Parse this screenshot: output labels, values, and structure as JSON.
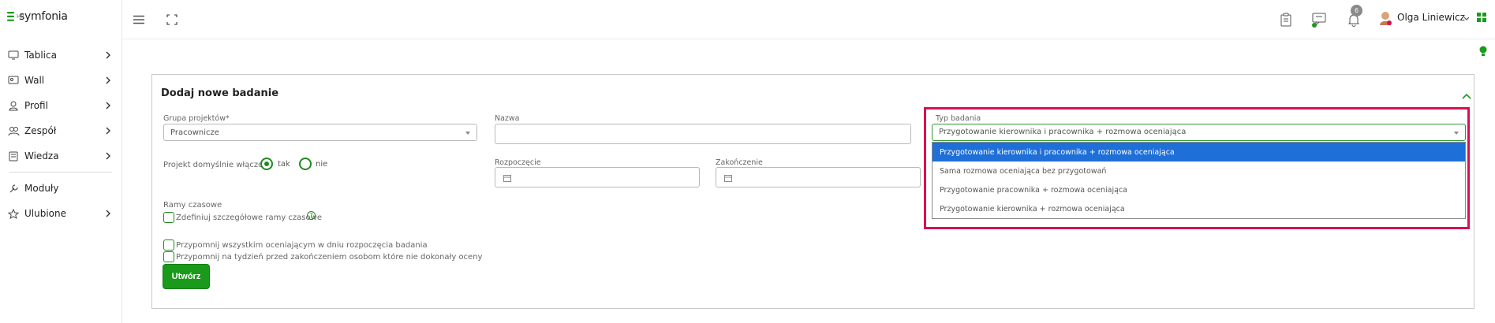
{
  "app": {
    "logo_text": "symfonia",
    "logo_sub": "HR"
  },
  "sidebar": {
    "items": [
      {
        "label": "Tablica",
        "icon": "monitor-icon"
      },
      {
        "label": "Wall",
        "icon": "wall-icon"
      },
      {
        "label": "Profil",
        "icon": "user-icon"
      },
      {
        "label": "Zespół",
        "icon": "team-icon"
      },
      {
        "label": "Wiedza",
        "icon": "book-icon"
      },
      {
        "label": "Moduły",
        "icon": "wrench-icon"
      },
      {
        "label": "Ulubione",
        "icon": "star-icon"
      }
    ]
  },
  "topbar": {
    "notification_count": "6",
    "user_name": "Olga Liniewicz"
  },
  "form": {
    "title": "Dodaj nowe badanie",
    "group_label": "Grupa projektów*",
    "group_value": "Pracownicze",
    "name_label": "Nazwa",
    "name_value": "",
    "type_label": "Typ badania",
    "type_value": "Przygotowanie kierownika i pracownika + rozmowa oceniająca",
    "default_project_label": "Projekt domyślnie włączony",
    "radio_yes": "tak",
    "radio_no": "nie",
    "start_label": "Rozpoczęcie",
    "end_label": "Zakończenie",
    "timeframe_label": "Ramy czasowe",
    "timeframe_checkbox": "Zdefiniuj szczegółowe ramy czasowe",
    "help_glyph": "?",
    "remind_all": "Przypomnij wszystkim oceniającym w dniu rozpoczęcia badania",
    "remind_week": "Przypomnij na tydzień przed zakończeniem osobom które nie dokonały oceny",
    "submit": "Utwórz"
  },
  "dropdown": {
    "options": [
      "Przygotowanie kierownika i pracownika + rozmowa oceniająca",
      "Sama rozmowa oceniająca bez przygotowań",
      "Przygotowanie pracownika + rozmowa oceniająca",
      "Przygotowanie kierownika + rozmowa oceniająca"
    ],
    "selected_index": 0
  },
  "colors": {
    "accent": "#1a9a1a",
    "highlight": "#d6114f",
    "selected": "#1e6fd8"
  }
}
